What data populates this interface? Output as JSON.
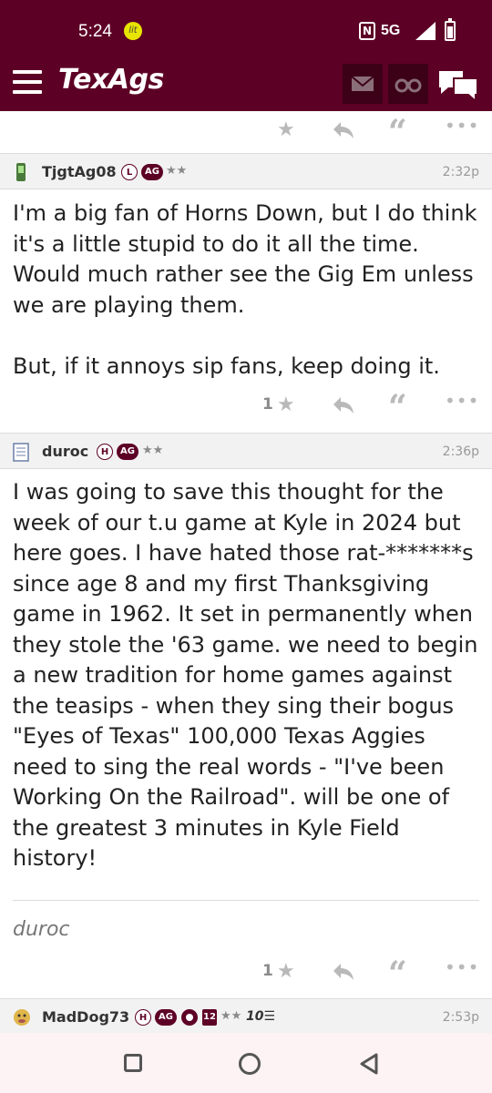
{
  "status": {
    "time": "5:24",
    "app_badge": "lit",
    "network": "5G"
  },
  "header": {
    "logo": "TexAgs"
  },
  "posts": [
    {
      "username": "TjgtAg08",
      "badge_letter": "L",
      "badge_ag": "AG",
      "stars": "★★",
      "time": "2:32p",
      "body": "I'm a big fan of Horns Down, but I do think it's a little stupid to do it all the time. Would much rather see the Gig Em unless we are playing them.\n\nBut, if it annoys sip fans, keep doing it.",
      "star_count": "1"
    },
    {
      "username": "duroc",
      "badge_letter": "H",
      "badge_ag": "AG",
      "stars": "★★",
      "time": "2:36p",
      "body": "I was going to save this thought for the week of our t.u game at Kyle in 2024 but here goes. I have hated those rat-*******s since age 8 and my first Thanksgiving game in 1962. It set in permanently when they stole the '63 game. we need to begin a new tradition for home games against the teasips - when they sing their bogus \"Eyes of Texas\" 100,000 Texas Aggies need to sing the real words - \"I've been Working On the Railroad\". will be one of the greatest 3 minutes in Kyle Field history!",
      "signature": "duroc",
      "star_count": "1"
    },
    {
      "username": "MadDog73",
      "badge_letter": "H",
      "badge_ag": "AG",
      "badge_12": "12",
      "stars": "★★",
      "badge_10": "10☰",
      "time": "2:53p"
    }
  ],
  "icons": {
    "star": "star-icon",
    "reply": "reply-icon",
    "quote": "quote-icon",
    "more": "more-icon"
  },
  "colors": {
    "brand": "#5d0025",
    "header_bg": "#f2f2f2"
  }
}
